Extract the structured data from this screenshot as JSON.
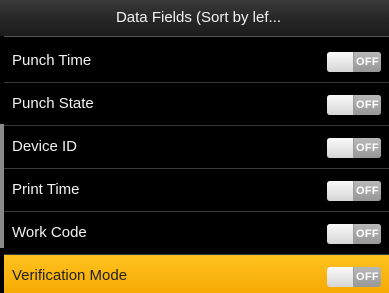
{
  "header": {
    "title": "Data Fields (Sort by lef..."
  },
  "fields": [
    {
      "label": "Punch Time",
      "toggle": "OFF"
    },
    {
      "label": "Punch State",
      "toggle": "OFF"
    },
    {
      "label": "Device ID",
      "toggle": "OFF"
    },
    {
      "label": "Print Time",
      "toggle": "OFF"
    },
    {
      "label": "Work Code",
      "toggle": "OFF"
    },
    {
      "label": "Verification Mode",
      "toggle": "OFF"
    }
  ],
  "selected_field": "Verification Mode",
  "colors": {
    "selected_bg": "#f5a800",
    "toggle_off": "#a0a0a0"
  }
}
